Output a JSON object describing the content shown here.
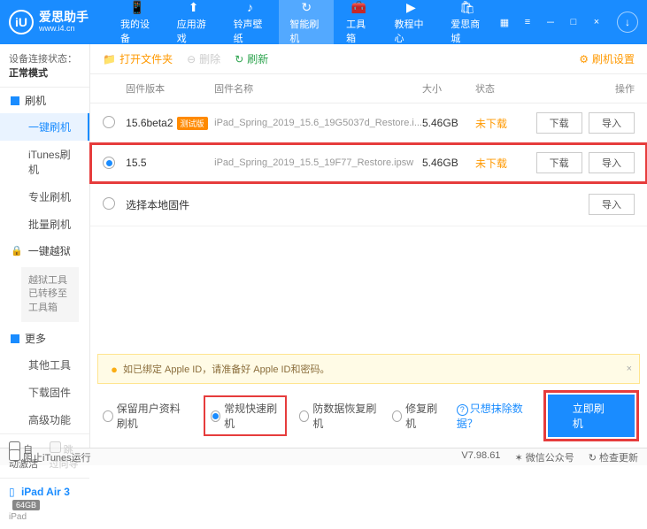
{
  "brand": {
    "name": "爱思助手",
    "url": "www.i4.cn",
    "logo_letter": "iU"
  },
  "nav": [
    {
      "label": "我的设备",
      "icon": "📱"
    },
    {
      "label": "应用游戏",
      "icon": "⬆"
    },
    {
      "label": "铃声壁纸",
      "icon": "♪"
    },
    {
      "label": "智能刷机",
      "icon": "↻",
      "active": true
    },
    {
      "label": "工具箱",
      "icon": "🧰"
    },
    {
      "label": "教程中心",
      "icon": "▶"
    },
    {
      "label": "爱思商城",
      "icon": "🛍"
    }
  ],
  "sidebar": {
    "conn_label": "设备连接状态：",
    "conn_value": "正常模式",
    "sections": [
      {
        "title": "刷机",
        "type": "blue",
        "items": [
          {
            "label": "一键刷机",
            "active": true
          },
          {
            "label": "iTunes刷机"
          },
          {
            "label": "专业刷机"
          },
          {
            "label": "批量刷机"
          }
        ]
      },
      {
        "title": "一键越狱",
        "type": "lock",
        "note": "越狱工具已转移至工具箱"
      },
      {
        "title": "更多",
        "type": "blue",
        "items": [
          {
            "label": "其他工具"
          },
          {
            "label": "下载固件"
          },
          {
            "label": "高级功能"
          }
        ]
      }
    ],
    "checks": {
      "auto_activate": "自动激活",
      "skip_guide": "跳过向导"
    },
    "device": {
      "name": "iPad Air 3",
      "badge": "64GB",
      "sub": "iPad"
    }
  },
  "toolbar": {
    "open_folder": "打开文件夹",
    "delete": "删除",
    "refresh": "刷新",
    "settings": "刷机设置"
  },
  "table": {
    "headers": {
      "version": "固件版本",
      "name": "固件名称",
      "size": "大小",
      "status": "状态",
      "ops": "操作"
    },
    "rows": [
      {
        "selected": false,
        "version": "15.6beta2",
        "beta": "测试版",
        "name": "iPad_Spring_2019_15.6_19G5037d_Restore.i...",
        "size": "5.46GB",
        "status": "未下载"
      },
      {
        "selected": true,
        "version": "15.5",
        "beta": "",
        "name": "iPad_Spring_2019_15.5_19F77_Restore.ipsw",
        "size": "5.46GB",
        "status": "未下载"
      }
    ],
    "local_fw": "选择本地固件",
    "btn_download": "下载",
    "btn_import": "导入"
  },
  "notice": "如已绑定 Apple ID，请准备好 Apple ID和密码。",
  "flash": {
    "opts": [
      {
        "label": "保留用户资料刷机",
        "checked": false
      },
      {
        "label": "常规快速刷机",
        "checked": true,
        "boxed": true
      },
      {
        "label": "防数据恢复刷机",
        "checked": false
      },
      {
        "label": "修复刷机",
        "checked": false
      }
    ],
    "help": "只想抹除数据？",
    "go": "立即刷机"
  },
  "statusbar": {
    "block_itunes": "阻止iTunes运行",
    "version": "V7.98.61",
    "wechat": "微信公众号",
    "check_update": "检查更新"
  }
}
